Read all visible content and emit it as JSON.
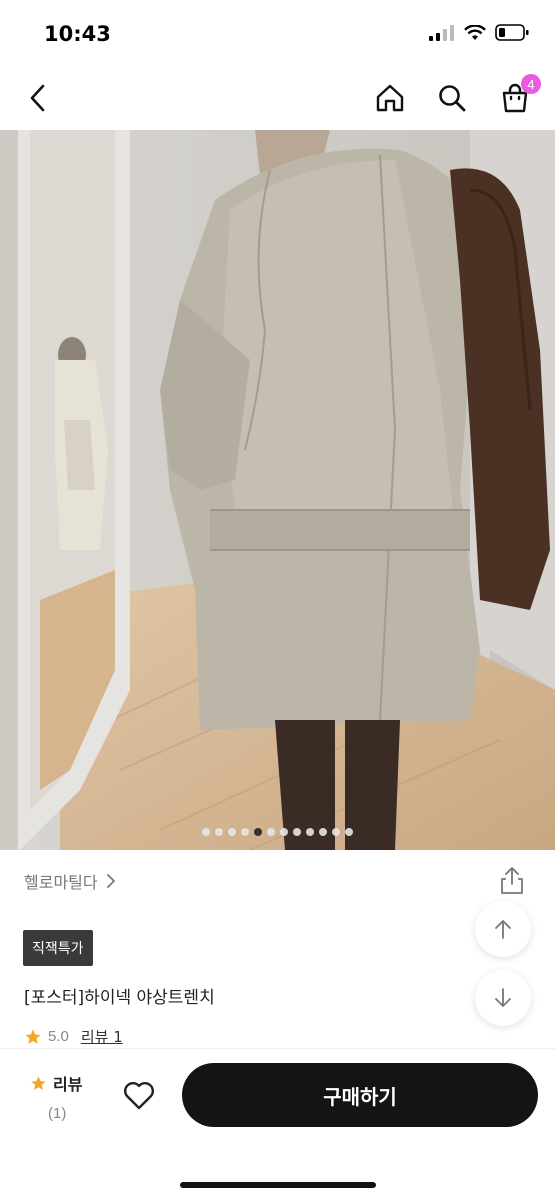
{
  "status": {
    "time": "10:43"
  },
  "nav": {
    "cart_count": "4"
  },
  "carousel": {
    "total": 12,
    "active_index": 4
  },
  "shop": {
    "name": "헬로마틸다"
  },
  "product": {
    "badge": "직잭특가",
    "title": "[포스터]하이넥 야상트렌치",
    "rating": "5.0",
    "review_link": "리뷰 1"
  },
  "bottom": {
    "review_label": "리뷰",
    "review_count": "(1)",
    "buy_label": "구매하기"
  },
  "colors": {
    "accent_star": "#f5a623",
    "badge_pink": "#e95ce0",
    "buy_button": "#141414"
  }
}
